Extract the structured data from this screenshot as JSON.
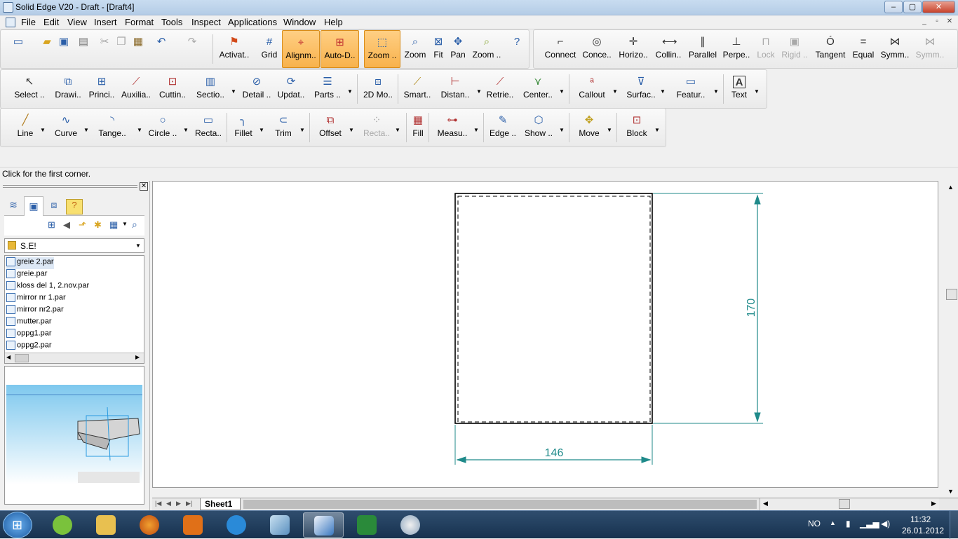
{
  "window": {
    "title": "Solid Edge V20 - Draft - [Draft4]",
    "controls": {
      "minimize": "–",
      "maximize": "▢",
      "close": "✕"
    },
    "mdi_controls": {
      "minimize": "_",
      "restore": "▫",
      "close": "✕"
    }
  },
  "menu": [
    "File",
    "Edit",
    "View",
    "Insert",
    "Format",
    "Tools",
    "Inspect",
    "Applications",
    "Window",
    "Help"
  ],
  "toolbar1": {
    "main": [
      "Activat..",
      "Grid",
      "Alignm..",
      "Auto-D..",
      "Zoom ..",
      "Zoom",
      "Fit",
      "Pan",
      "Zoom .."
    ],
    "relations": [
      "Connect",
      "Conce..",
      "Horizo..",
      "Collin..",
      "Parallel",
      "Perpe..",
      "Lock",
      "Rigid ..",
      "Tangent",
      "Equal",
      "Symm..",
      "Symm.."
    ]
  },
  "toolbar2": [
    "Select ..",
    "Drawi..",
    "Princi..",
    "Auxilia..",
    "Cuttin..",
    "Sectio..",
    "Detail ..",
    "Updat..",
    "Parts ..",
    "2D Mo..",
    "Smart..",
    "Distan..",
    "Retrie..",
    "Center..",
    "Callout",
    "Surfac..",
    "Featur..",
    "Text"
  ],
  "toolbar3": [
    "Line",
    "Curve",
    "Tange..",
    "Circle ..",
    "Recta..",
    "Fillet",
    "Trim",
    "Offset",
    "Recta..",
    "Fill",
    "Measu..",
    "Edge ..",
    "Show ..",
    "Move",
    "Block"
  ],
  "status": "Click for the first corner.",
  "library": {
    "folder": "S.E!",
    "files": [
      "greie 2.par",
      "greie.par",
      "kloss del 1, 2.nov.par",
      "mirror nr 1.par",
      "mirror nr2.par",
      "mutter.par",
      "oppg1.par",
      "oppg2.par"
    ]
  },
  "drawing": {
    "dimension_width": "146",
    "dimension_height": "170"
  },
  "sheet_tab": "Sheet1",
  "taskbar": {
    "language": "NO",
    "time": "11:32",
    "date": "26.01.2012"
  },
  "colors": {
    "active_button": "#f8b24c",
    "dimension": "#1f8a8a",
    "taskbar": "#17324f"
  }
}
